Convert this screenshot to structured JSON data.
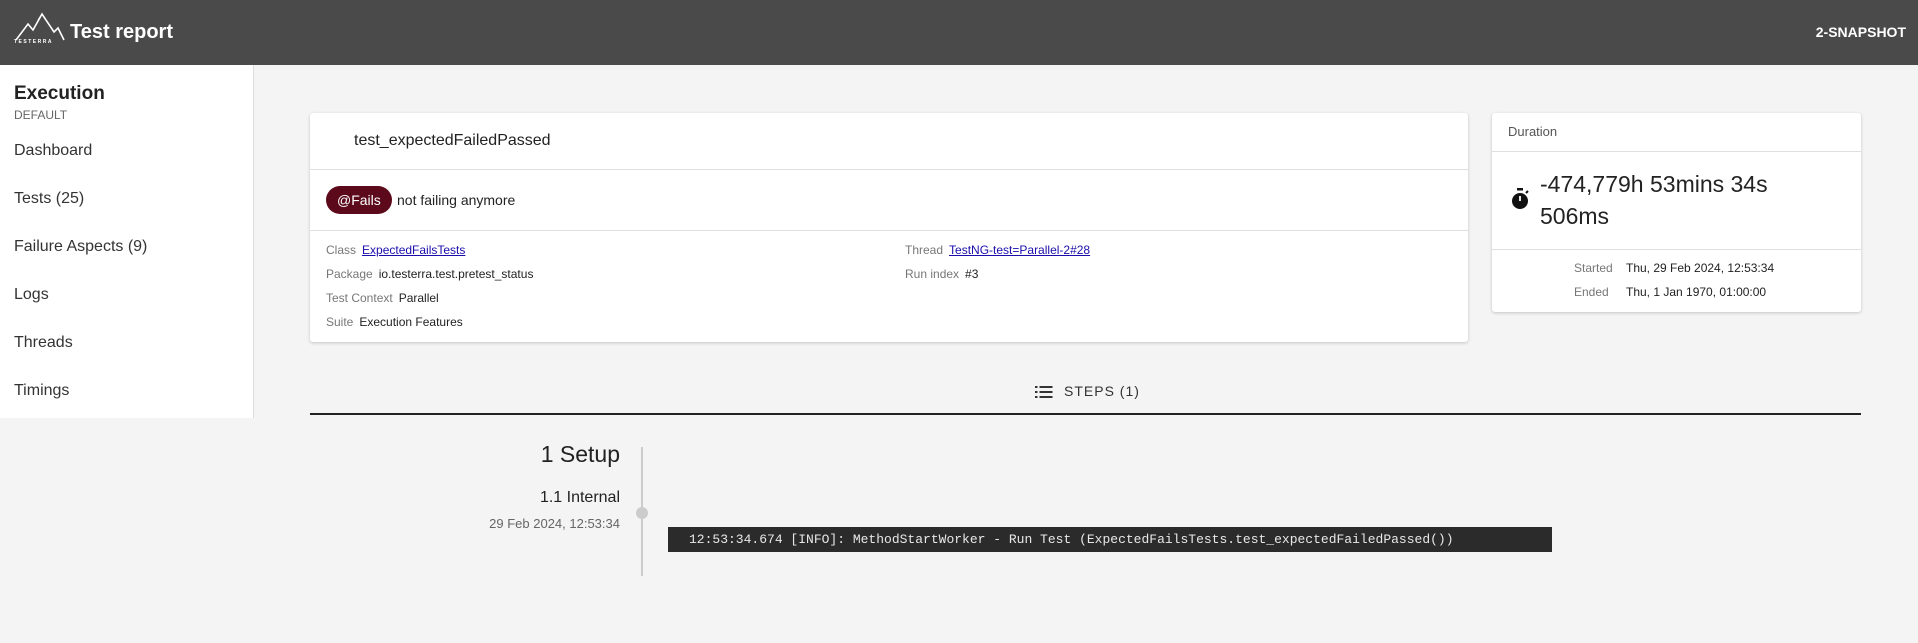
{
  "topbar": {
    "logo_text": "TESTERRA",
    "title": "Test report",
    "version": "2-SNAPSHOT"
  },
  "sidebar": {
    "title": "Execution",
    "subtitle": "DEFAULT",
    "items": [
      {
        "label": "Dashboard"
      },
      {
        "label": "Tests (25)"
      },
      {
        "label": "Failure Aspects (9)"
      },
      {
        "label": "Logs"
      },
      {
        "label": "Threads"
      },
      {
        "label": "Timings"
      }
    ]
  },
  "test": {
    "name": "test_expectedFailedPassed",
    "badge": "@Fails",
    "badge_message": "not failing anymore",
    "badge_color": "#5c0a1b",
    "props": {
      "class_label": "Class",
      "class_value": "ExpectedFailsTests",
      "package_label": "Package",
      "package_value": "io.testerra.test.pretest_status",
      "context_label": "Test Context",
      "context_value": "Parallel",
      "suite_label": "Suite",
      "suite_value": "Execution Features",
      "thread_label": "Thread",
      "thread_value": "TestNG-test=Parallel-2#28",
      "runindex_label": "Run index",
      "runindex_value": "#3"
    }
  },
  "duration": {
    "title": "Duration",
    "icon": "stopwatch-icon",
    "value": "-474,779h 53mins 34s 506ms",
    "started_label": "Started",
    "started_value": "Thu, 29 Feb 2024, 12:53:34",
    "ended_label": "Ended",
    "ended_value": "Thu, 1 Jan 1970, 01:00:00"
  },
  "steps": {
    "tab_label": "STEPS (1)",
    "icon": "list-icon",
    "step_title": "1 Setup",
    "substep_title": "1.1 Internal",
    "substep_time": "29 Feb 2024, 12:53:34",
    "log_line": "12:53:34.674 [INFO]: MethodStartWorker - Run Test (ExpectedFailsTests.test_expectedFailedPassed())"
  }
}
